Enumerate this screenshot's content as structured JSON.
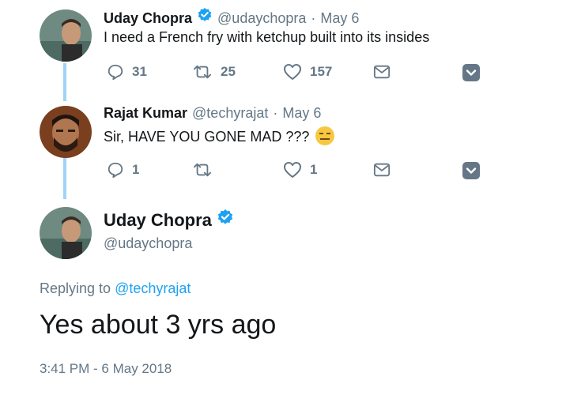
{
  "thread": [
    {
      "name": "Uday Chopra",
      "handle": "@udaychopra",
      "dot": "·",
      "date": "May 6",
      "text": "I need a French fry with ketchup built into its insides",
      "replies": "31",
      "retweets": "25",
      "likes": "157"
    },
    {
      "name": "Rajat Kumar",
      "handle": "@techyrajat",
      "dot": "·",
      "date": "May 6",
      "text": "Sir, HAVE YOU GONE MAD ???",
      "emoji": "expressionless-face",
      "replies": "1",
      "retweets": "",
      "likes": "1"
    }
  ],
  "main": {
    "name": "Uday Chopra",
    "handle": "@udaychopra",
    "replying_prefix": "Replying to",
    "replying_to": "@techyrajat",
    "text": "Yes about 3 yrs ago",
    "timestamp": "3:41 PM - 6 May 2018"
  },
  "colors": {
    "accent": "#1da1f2",
    "muted": "#657786",
    "thread_line": "#9fd4f5"
  }
}
